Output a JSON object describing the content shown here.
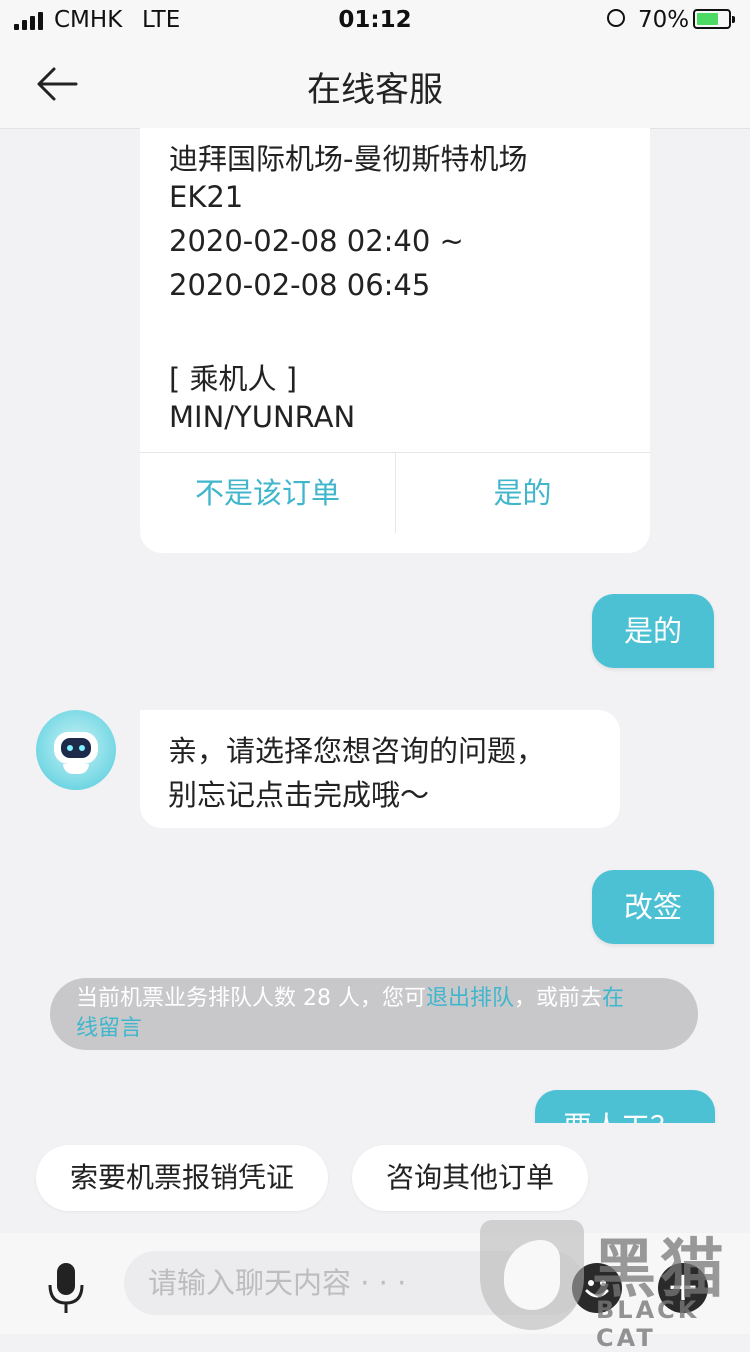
{
  "status_bar": {
    "carrier": "CMHK",
    "network": "LTE",
    "time": "01:12",
    "battery_percent": "70%"
  },
  "header": {
    "title": "在线客服"
  },
  "order_card": {
    "route": "迪拜国际机场-曼彻斯特机场",
    "flight_no": "EK21",
    "depart_time": "2020-02-08 02:40 ~",
    "arrive_time": "2020-02-08 06:45",
    "passenger_label": "[ 乘机人 ]",
    "passenger_name": "MIN/YUNRAN",
    "reject_option": "不是该订单",
    "confirm_option": "是的"
  },
  "messages": {
    "user_confirm": "是的",
    "bot_line1": "亲，请选择您想咨询的问题，",
    "bot_line2": "别忘记点击完成哦～",
    "user_change": "改签",
    "user_partial": "要人工？"
  },
  "queue_notice": {
    "prefix": "当前机票业务排队人数 28 人，您可",
    "exit_link": "退出排队",
    "middle": "，或前去",
    "leave_msg_part1": "在",
    "leave_msg_part2": "线留言"
  },
  "quick_replies": [
    "索要机票报销凭证",
    "咨询其他订单"
  ],
  "input": {
    "placeholder": "请输入聊天内容 · · ·"
  },
  "watermark": {
    "cn": "黑猫",
    "en": "BLACK CAT"
  },
  "colors": {
    "accent": "#4dc1d4",
    "link": "#3fb6cc",
    "background": "#f2f2f4"
  },
  "icons": [
    "back-arrow-icon",
    "mic-icon",
    "emoji-icon",
    "plus-icon",
    "robot-avatar-icon",
    "signal-icon",
    "battery-icon",
    "rotation-lock-icon"
  ]
}
